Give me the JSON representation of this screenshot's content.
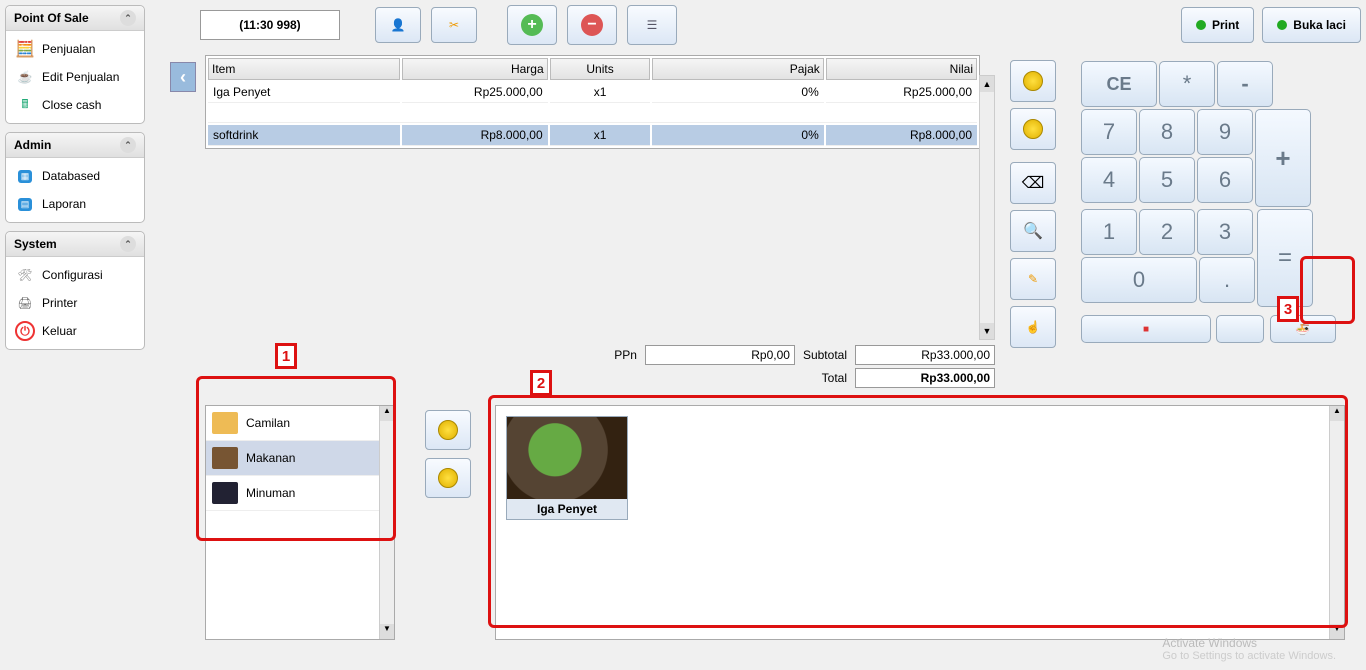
{
  "sidebar": {
    "panels": [
      {
        "title": "Point Of Sale",
        "items": [
          {
            "label": "Penjualan"
          },
          {
            "label": "Edit Penjualan"
          },
          {
            "label": "Close cash"
          }
        ]
      },
      {
        "title": "Admin",
        "items": [
          {
            "label": "Databased"
          },
          {
            "label": "Laporan"
          }
        ]
      },
      {
        "title": "System",
        "items": [
          {
            "label": "Configurasi"
          },
          {
            "label": "Printer"
          },
          {
            "label": "Keluar"
          }
        ]
      }
    ]
  },
  "topbar": {
    "time": "(11:30 998)",
    "print": "Print",
    "buka_laci": "Buka laci"
  },
  "table": {
    "headers": {
      "item": "Item",
      "harga": "Harga",
      "units": "Units",
      "pajak": "Pajak",
      "nilai": "Nilai"
    },
    "rows": [
      {
        "item": "Iga Penyet",
        "harga": "Rp25.000,00",
        "units": "x1",
        "pajak": "0%",
        "nilai": "Rp25.000,00",
        "selected": false
      },
      {
        "item": "softdrink",
        "harga": "Rp8.000,00",
        "units": "x1",
        "pajak": "0%",
        "nilai": "Rp8.000,00",
        "selected": true
      }
    ]
  },
  "totals": {
    "ppn_label": "PPn",
    "ppn_value": "Rp0,00",
    "subtotal_label": "Subtotal",
    "subtotal_value": "Rp33.000,00",
    "total_label": "Total",
    "total_value": "Rp33.000,00"
  },
  "keypad": {
    "ce": "CE",
    "star": "*",
    "minus": "-",
    "plus": "+",
    "equals": "=",
    "n7": "7",
    "n8": "8",
    "n9": "9",
    "n4": "4",
    "n5": "5",
    "n6": "6",
    "n1": "1",
    "n2": "2",
    "n3": "3",
    "n0": "0",
    "dot": "."
  },
  "categories": [
    {
      "label": "Camilan",
      "selected": false
    },
    {
      "label": "Makanan",
      "selected": true
    },
    {
      "label": "Minuman",
      "selected": false
    }
  ],
  "products": [
    {
      "label": "Iga Penyet"
    }
  ],
  "annotations": {
    "a1": "1",
    "a2": "2",
    "a3": "3"
  },
  "watermark": {
    "title": "Activate Windows",
    "sub": "Go to Settings to activate Windows."
  }
}
